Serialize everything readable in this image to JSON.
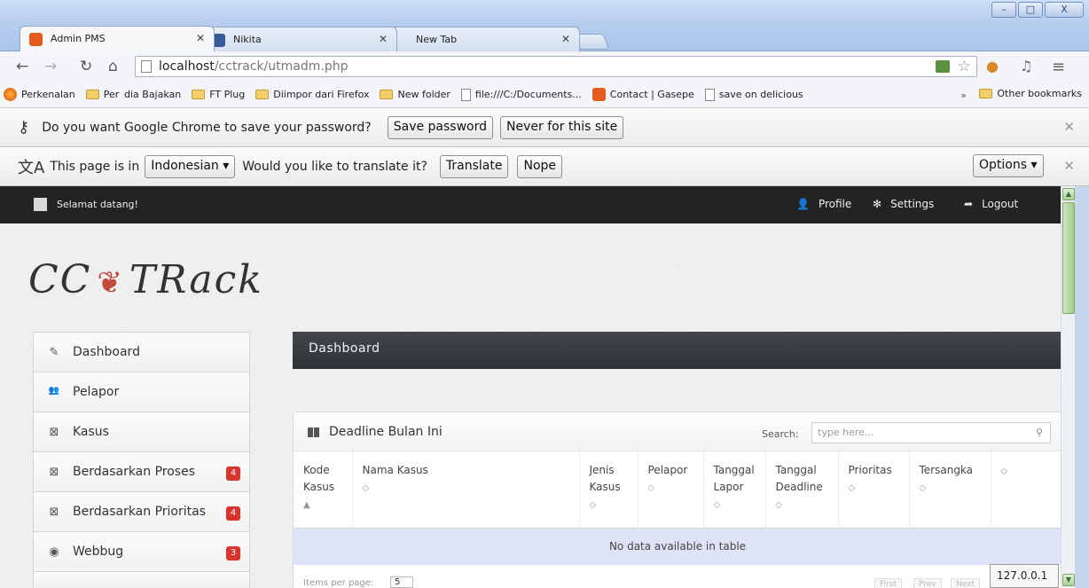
{
  "window": {
    "controls": {
      "minimize": "–",
      "maximize": "□",
      "close": "X"
    }
  },
  "tabs": [
    {
      "title": "Admin PMS",
      "favicon_color": "#e55b1e",
      "active": true
    },
    {
      "title": "Nikita",
      "favicon_color": "#3b5998",
      "active": false
    },
    {
      "title": "New Tab",
      "favicon_color": "",
      "active": false
    }
  ],
  "toolbar": {
    "url_host": "localhost",
    "url_path": "/cctrack/utmadm.php"
  },
  "bookmarks": {
    "items": [
      {
        "label": "Perkenalan",
        "icon": "firefox-icon"
      },
      {
        "label": "Per  dia Bajakan",
        "icon": "folder-icon"
      },
      {
        "label": "FT Plug",
        "icon": "folder-icon"
      },
      {
        "label": "Diimpor dari Firefox",
        "icon": "folder-icon"
      },
      {
        "label": "New folder",
        "icon": "folder-icon"
      },
      {
        "label": "file:///C:/Documents...",
        "icon": "page-icon"
      },
      {
        "label": "Contact | Gasepe",
        "icon": "gasepe-icon"
      },
      {
        "label": "save on delicious",
        "icon": "page-icon"
      }
    ],
    "more": "»",
    "other": "Other bookmarks"
  },
  "password_bar": {
    "message": "Do you want Google Chrome to save your password?",
    "save_label": "Save password",
    "never_label": "Never for this site"
  },
  "translate_bar": {
    "prefix": "This page is in",
    "language": "Indonesian ▾",
    "question": "Would you like to translate it?",
    "translate_label": "Translate",
    "nope_label": "Nope",
    "options_label": "Options ▾"
  },
  "topnav": {
    "welcome": "Selamat datang!",
    "profile": "Profile",
    "settings": "Settings",
    "logout": "Logout"
  },
  "logo": {
    "left": "CC",
    "right": "TRack"
  },
  "sidebar": {
    "items": [
      {
        "label": "Dashboard",
        "icon": "pencil-icon",
        "glyph": "✎",
        "badge": ""
      },
      {
        "label": "Pelapor",
        "icon": "users-icon",
        "glyph": "👥",
        "badge": ""
      },
      {
        "label": "Kasus",
        "icon": "box-icon",
        "glyph": "⊠",
        "badge": ""
      },
      {
        "label": "Berdasarkan Proses",
        "icon": "box-icon",
        "glyph": "⊠",
        "badge": "4"
      },
      {
        "label": "Berdasarkan Prioritas",
        "icon": "box-icon",
        "glyph": "⊠",
        "badge": "4"
      },
      {
        "label": "Webbug",
        "icon": "eye-icon",
        "glyph": "◉",
        "badge": "3"
      }
    ]
  },
  "main": {
    "header": "Dashboard",
    "panel": {
      "title": "Deadline Bulan Ini",
      "search_label": "Search:",
      "search_placeholder": "type here...",
      "columns": [
        {
          "label": "Kode Kasus",
          "sort": "▲"
        },
        {
          "label": "Nama Kasus",
          "sort": "◇"
        },
        {
          "label": "Jenis Kasus",
          "sort": "◇"
        },
        {
          "label": "Pelapor",
          "sort": "◇"
        },
        {
          "label": "Tanggal Lapor",
          "sort": "◇"
        },
        {
          "label": "Tanggal Deadline",
          "sort": "◇"
        },
        {
          "label": "Prioritas",
          "sort": "◇"
        },
        {
          "label": "Tersangka",
          "sort": "◇"
        },
        {
          "label": "",
          "sort": "◇"
        }
      ],
      "empty_message": "No data available in table",
      "items_per_page_label": "Items per page:",
      "items_per_page_value": "5",
      "pager": [
        "First",
        "Prev",
        "Next"
      ]
    }
  },
  "status_tip": "127.0.0.1",
  "colors": {
    "accent_red": "#d9332b",
    "topnav_bg": "#232323",
    "empty_row": "#dfe3f7"
  }
}
